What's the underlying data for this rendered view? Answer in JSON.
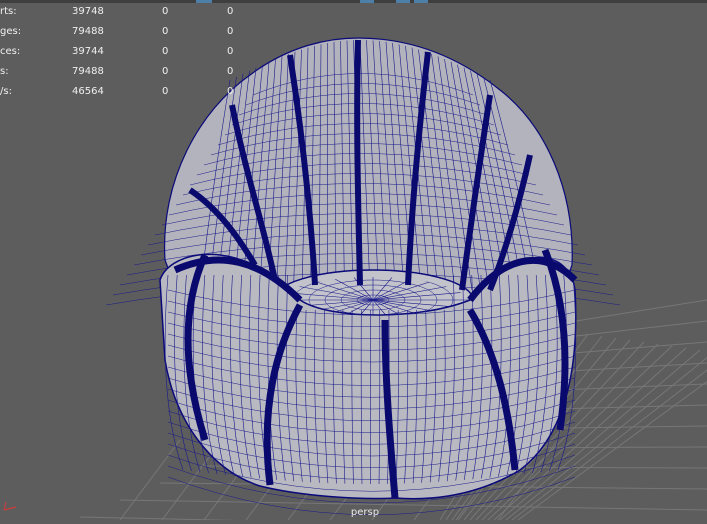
{
  "hud": {
    "rows": [
      {
        "label": "rts:",
        "v1": "39748",
        "v2": "0",
        "v3": "0"
      },
      {
        "label": "ges:",
        "v1": "79488",
        "v2": "0",
        "v3": "0"
      },
      {
        "label": "ces:",
        "v1": "39744",
        "v2": "0",
        "v3": "0"
      },
      {
        "label": "s:",
        "v1": "79488",
        "v2": "0",
        "v3": "0"
      },
      {
        "label": "/s:",
        "v1": "46564",
        "v2": "0",
        "v3": "0"
      }
    ]
  },
  "viewport": {
    "camera_label": "persp"
  },
  "colors": {
    "background": "#5d5d5d",
    "grid": "#7a7a7a",
    "mesh_fill": "#b9b9c2",
    "wire": "#0a0a7a"
  },
  "icons": {
    "axis": "axis-gizmo-icon"
  }
}
